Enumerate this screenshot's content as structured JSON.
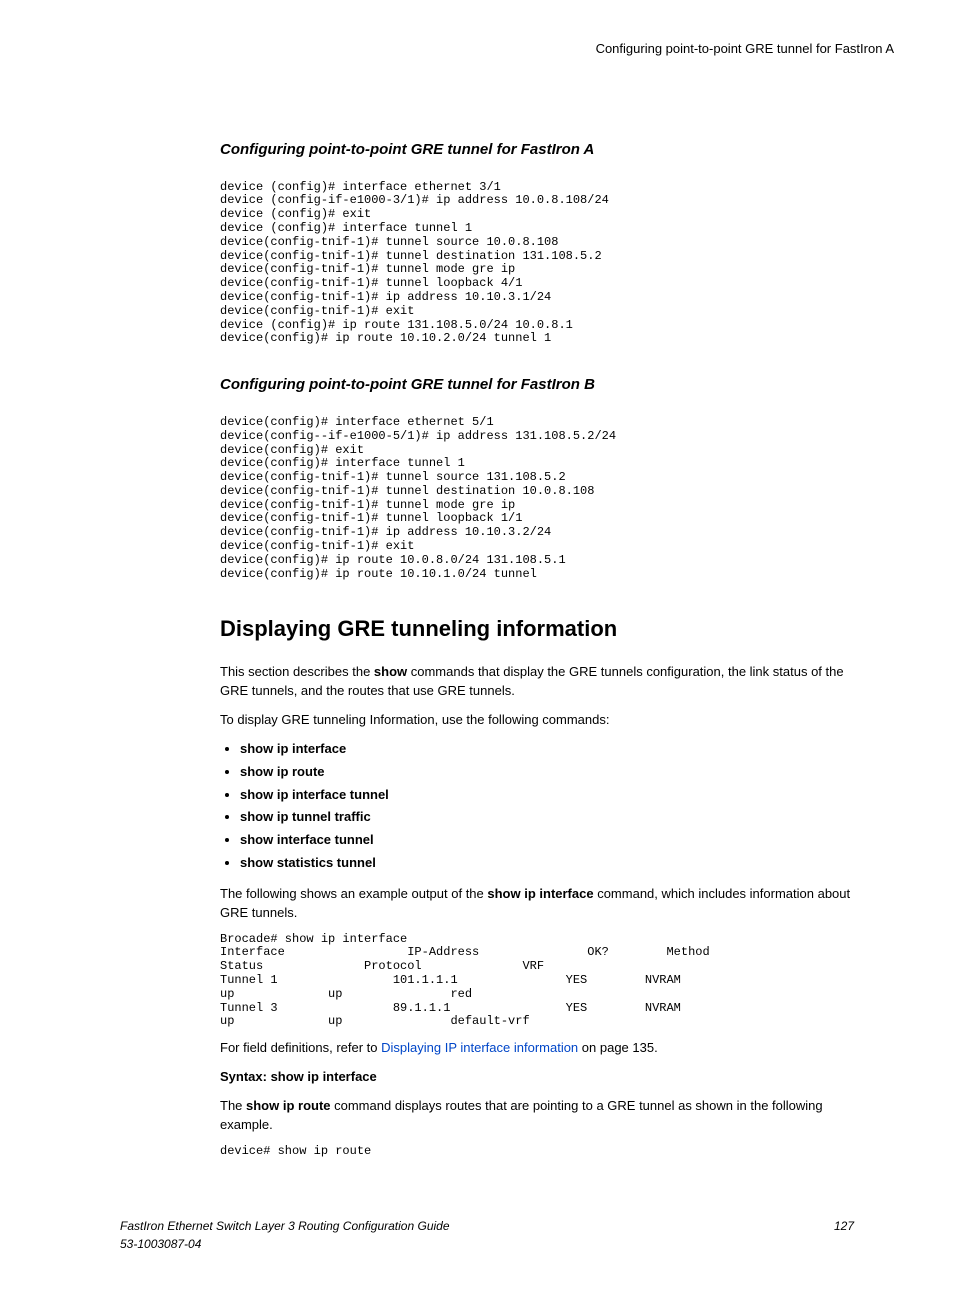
{
  "header": {
    "running_title": "Configuring point-to-point GRE tunnel for FastIron A"
  },
  "section_a": {
    "heading": "Configuring point-to-point GRE tunnel for FastIron A",
    "code": "device (config)# interface ethernet 3/1\ndevice (config-if-e1000-3/1)# ip address 10.0.8.108/24\ndevice (config)# exit\ndevice (config)# interface tunnel 1\ndevice(config-tnif-1)# tunnel source 10.0.8.108\ndevice(config-tnif-1)# tunnel destination 131.108.5.2\ndevice(config-tnif-1)# tunnel mode gre ip\ndevice(config-tnif-1)# tunnel loopback 4/1\ndevice(config-tnif-1)# ip address 10.10.3.1/24\ndevice(config-tnif-1)# exit\ndevice (config)# ip route 131.108.5.0/24 10.0.8.1\ndevice(config)# ip route 10.10.2.0/24 tunnel 1"
  },
  "section_b": {
    "heading": "Configuring point-to-point GRE tunnel for FastIron B",
    "code": "device(config)# interface ethernet 5/1\ndevice(config--if-e1000-5/1)# ip address 131.108.5.2/24\ndevice(config)# exit\ndevice(config)# interface tunnel 1\ndevice(config-tnif-1)# tunnel source 131.108.5.2\ndevice(config-tnif-1)# tunnel destination 10.0.8.108\ndevice(config-tnif-1)# tunnel mode gre ip\ndevice(config-tnif-1)# tunnel loopback 1/1\ndevice(config-tnif-1)# ip address 10.10.3.2/24\ndevice(config-tnif-1)# exit\ndevice(config)# ip route 10.0.8.0/24 131.108.5.1\ndevice(config)# ip route 10.10.1.0/24 tunnel"
  },
  "section_display": {
    "heading": "Displaying GRE tunneling information",
    "p1_a": "This section describes the ",
    "p1_b": "show",
    "p1_c": " commands that display the GRE tunnels configuration, the link status of the GRE tunnels, and the routes that use GRE tunnels.",
    "p2": "To display GRE tunneling Information, use the following commands:",
    "cmds": [
      "show ip interface",
      "show ip route",
      "show ip interface tunnel",
      "show ip tunnel traffic",
      "show interface tunnel",
      "show statistics tunnel"
    ],
    "p3_a": "The following shows an example output of the ",
    "p3_b": "show ip interface",
    "p3_c": " command, which includes information about GRE tunnels.",
    "code1": "Brocade# show ip interface\nInterface                 IP-Address               OK?        Method    \nStatus              Protocol              VRF\nTunnel 1                101.1.1.1               YES        NVRAM       \nup             up               red\nTunnel 3                89.1.1.1                YES        NVRAM       \nup             up               default-vrf",
    "p4_a": "For field definitions, refer to ",
    "p4_link": "Displaying IP interface information",
    "p4_b": " on page 135.",
    "syntax": "Syntax: show ip interface",
    "p5_a": "The ",
    "p5_b": "show ip route",
    "p5_c": " command displays routes that are pointing to a GRE tunnel as shown in the following example.",
    "code2": "device# show ip route"
  },
  "footer": {
    "left_line1": "FastIron Ethernet Switch Layer 3 Routing Configuration Guide",
    "left_line2": "53-1003087-04",
    "page": "127"
  }
}
